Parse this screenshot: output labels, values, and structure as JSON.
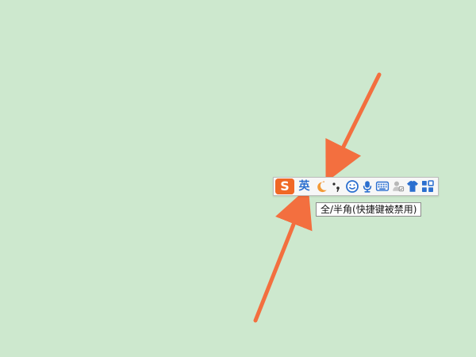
{
  "toolbar": {
    "logo_letter": "S",
    "language_label": "英",
    "icons": {
      "logo": "sogou-logo-icon",
      "moon": "moon-icon",
      "punctuation": "punctuation-icon",
      "emoji": "emoji-icon",
      "mic": "microphone-icon",
      "keyboard": "keyboard-icon",
      "user": "user-icon",
      "skin": "shirt-icon",
      "toolbox": "grid-icon"
    }
  },
  "tooltip": {
    "text": "全/半角(快捷键被禁用)"
  },
  "colors": {
    "background": "#cde8ce",
    "arrow": "#f36f3f",
    "brand": "#f06826",
    "icon_blue": "#2b6fcf"
  }
}
